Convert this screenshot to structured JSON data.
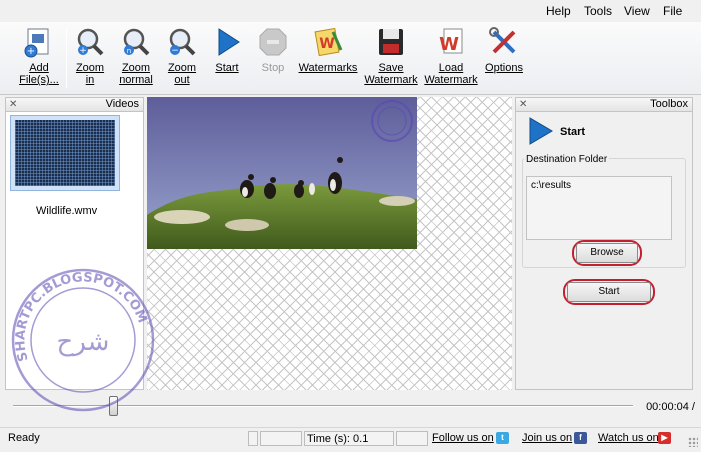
{
  "menu": {
    "help": "Help",
    "tools": "Tools",
    "view": "View",
    "file": "File"
  },
  "toolbar": {
    "add_files": [
      "Add",
      "File(s)..."
    ],
    "zoom_in": [
      "Zoom",
      "in"
    ],
    "zoom_normal": [
      "Zoom",
      "normal"
    ],
    "zoom_out": [
      "Zoom",
      "out"
    ],
    "start": "Start",
    "stop": "Stop",
    "watermarks": "Watermarks",
    "save_watermark": [
      "Save",
      "Watermark"
    ],
    "load_watermark": [
      "Load",
      "Watermark"
    ],
    "options": "Options"
  },
  "videos_panel": {
    "title": "Videos",
    "items": [
      {
        "label": "Wildlife.wmv"
      }
    ]
  },
  "toolbox": {
    "title": "Toolbox",
    "start_label": "Start",
    "destination_label": "Destination Folder",
    "destination_value": "c:\\results",
    "browse": "Browse",
    "start_button": "Start"
  },
  "player": {
    "time": "00:00:04 /"
  },
  "status": {
    "ready": "Ready",
    "time_label": "Time (s): 0.1",
    "follow": "Follow us on",
    "join": "Join us on",
    "watch": "Watch us on"
  },
  "colors": {
    "accent_ring": "#c0202f",
    "start_blue": "#1e73c8"
  },
  "watermark_text": "SHARTPC.BLOGSPOT.COM"
}
